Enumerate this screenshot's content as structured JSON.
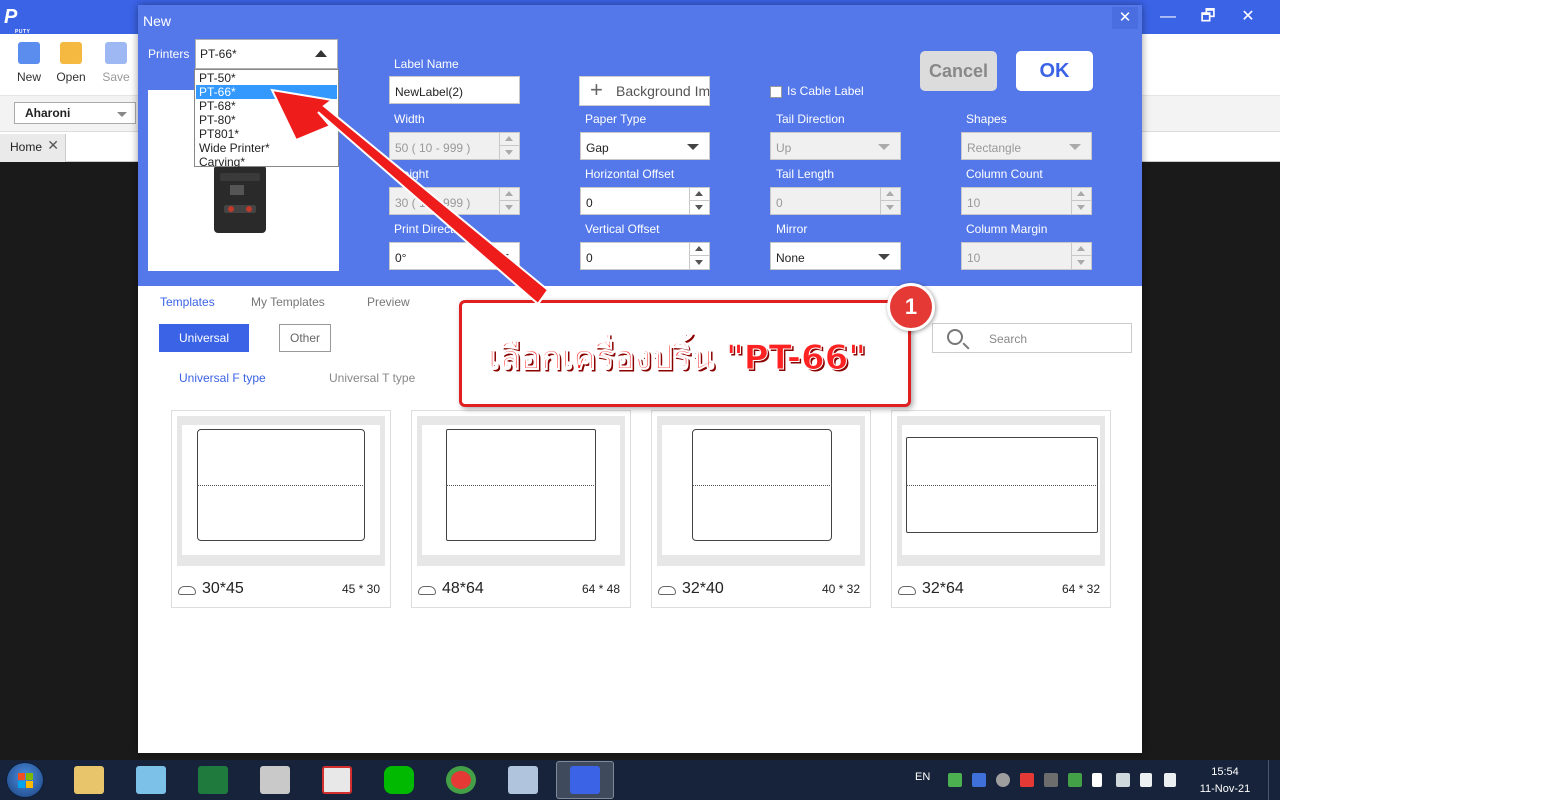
{
  "app": {
    "logo_text": "P",
    "logo_sub": "PUTY",
    "window_controls": {
      "minimize": "—",
      "restore": "🗗",
      "close": "✕"
    },
    "toolbar": [
      {
        "label": "New",
        "color": "#5b8def"
      },
      {
        "label": "Open",
        "color": "#f5b942"
      },
      {
        "label": "Save",
        "color": "#9db8f2"
      }
    ],
    "font_value": "Aharoni",
    "home_tab": {
      "label": "Home",
      "close": "✕"
    }
  },
  "dialog": {
    "title": "New",
    "close": "✕",
    "printers_label": "Printers",
    "printer_selected": "PT-66*",
    "printer_options": [
      "PT-50*",
      "PT-66*",
      "PT-68*",
      "PT-80*",
      "PT801*",
      "Wide Printer*",
      "Carving*"
    ],
    "printer_selected_index": 1,
    "label_name": {
      "label": "Label Name",
      "value": "NewLabel(2)"
    },
    "background_image": {
      "label": "Background Image"
    },
    "is_cable_label": {
      "label": "Is Cable Label",
      "checked": false
    },
    "cancel": "Cancel",
    "ok": "OK",
    "width": {
      "label": "Width",
      "placeholder": "50 ( 10 - 999 )"
    },
    "height": {
      "label": "Height",
      "placeholder": "30 ( 10 - 999 )"
    },
    "print_direction": {
      "label": "Print Direction",
      "value": "0°"
    },
    "paper_type": {
      "label": "Paper Type",
      "value": "Gap"
    },
    "horizontal_offset": {
      "label": "Horizontal Offset",
      "value": "0"
    },
    "vertical_offset": {
      "label": "Vertical Offset",
      "value": "0"
    },
    "tail_direction": {
      "label": "Tail Direction",
      "value": "Up"
    },
    "tail_length": {
      "label": "Tail Length",
      "value": "0"
    },
    "mirror": {
      "label": "Mirror",
      "value": "None"
    },
    "shapes": {
      "label": "Shapes",
      "value": "Rectangle"
    },
    "column_count": {
      "label": "Column Count",
      "value": "10"
    },
    "column_margin": {
      "label": "Column Margin",
      "value": "10"
    },
    "tabs": [
      "Templates",
      "My Templates",
      "Preview"
    ],
    "active_tab": "Templates",
    "categories": [
      "Universal",
      "Other"
    ],
    "subtypes": [
      "Universal F type",
      "Universal T type"
    ],
    "search_placeholder": "Search",
    "templates": [
      {
        "name": "30*45",
        "dim": "45 * 30"
      },
      {
        "name": "48*64",
        "dim": "64 * 48"
      },
      {
        "name": "32*40",
        "dim": "40 * 32"
      },
      {
        "name": "32*64",
        "dim": "64 * 32"
      }
    ]
  },
  "annotation": {
    "badge": "1",
    "text": "เลือกเครื่องปริ้น \"PT-66\""
  },
  "taskbar": {
    "language": "EN",
    "time": "15:54",
    "date": "11-Nov-21"
  },
  "colors": {
    "accent": "#3b63e6",
    "dialog_header": "#5478ea",
    "annotation_red": "#e02020",
    "taskbar": "#16233a"
  }
}
